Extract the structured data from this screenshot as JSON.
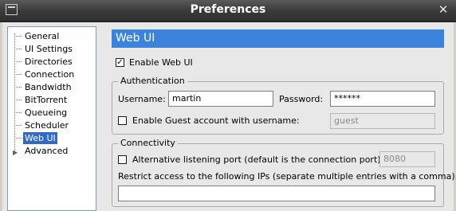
{
  "window": {
    "title": "Preferences"
  },
  "sidebar": {
    "items": [
      {
        "label": "General"
      },
      {
        "label": "UI Settings"
      },
      {
        "label": "Directories"
      },
      {
        "label": "Connection"
      },
      {
        "label": "Bandwidth"
      },
      {
        "label": "BitTorrent"
      },
      {
        "label": "Queueing"
      },
      {
        "label": "Scheduler"
      },
      {
        "label": "Web UI",
        "selected": true
      },
      {
        "label": "Advanced"
      }
    ]
  },
  "page": {
    "title": "Web UI",
    "enable_label": "Enable Web UI",
    "enable_checked": true,
    "auth": {
      "title": "Authentication",
      "username_label": "Username:",
      "username_value": "martin",
      "password_label": "Password:",
      "password_value": "******",
      "guest_label": "Enable Guest account with username:",
      "guest_checked": false,
      "guest_value": "guest"
    },
    "conn": {
      "title": "Connectivity",
      "alt_port_label": "Alternative listening port (default is the connection port):",
      "alt_port_checked": false,
      "alt_port_value": "8080",
      "restrict_label": "Restrict access to the following IPs (separate multiple entries with a comma):",
      "restrict_value": ""
    }
  }
}
